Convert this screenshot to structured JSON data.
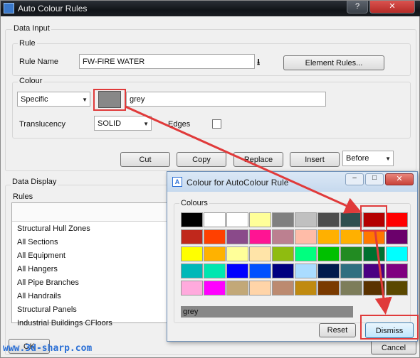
{
  "main_window": {
    "title": "Auto Colour Rules",
    "controls": [
      "?",
      "✕"
    ]
  },
  "data_input": {
    "group_label": "Data Input",
    "rule": {
      "group_label": "Rule",
      "name_label": "Rule Name",
      "name_value": "FW-FIRE WATER",
      "element_rules_button": "Element Rules..."
    },
    "colour": {
      "group_label": "Colour",
      "mode_value": "Specific",
      "swatch_color": "#888888",
      "colour_name": "grey",
      "translucency_label": "Translucency",
      "translucency_value": "SOLID",
      "edges_label": "Edges"
    },
    "buttons": {
      "cut": "Cut",
      "copy": "Copy",
      "replace": "Replace",
      "insert": "Insert",
      "position_value": "Before"
    }
  },
  "data_display": {
    "group_label": "Data Display",
    "rules_label": "Rules",
    "rows": [
      "Structural Hull Zones",
      "All Sections",
      "All Equipment",
      "All Hangers",
      "All Pipe Branches",
      "All Handrails",
      "Structural Panels",
      "Industrial Buildings CFloors"
    ],
    "ok_button": "OK",
    "cancel_button": "Cancel"
  },
  "colour_dialog": {
    "title": "Colour for AutoColour Rule",
    "group_label": "Colours",
    "palette": [
      [
        "#000000",
        "#ffffff",
        "#ffffff",
        "#ffff99",
        "#808080",
        "#c0c0c0",
        "#4d4d4d",
        "#2f4f4f",
        "#b40000",
        "#ff0000"
      ],
      [
        "#c0281c",
        "#ff4000",
        "#8a4a8a",
        "#ff1493",
        "#bc8090",
        "#ffbca8",
        "#ffb000",
        "#ffb000",
        "#ff7800",
        "#6b006b"
      ],
      [
        "#ffff00",
        "#ffb200",
        "#ffff99",
        "#ffe4a8",
        "#8fbc10",
        "#00ff7f",
        "#00c000",
        "#228b22",
        "#007030",
        "#00ffff"
      ],
      [
        "#00b8b8",
        "#00e6b0",
        "#0000ff",
        "#0050ff",
        "#000080",
        "#aadcff",
        "#001a4d",
        "#2f6f80",
        "#4b0082",
        "#800080"
      ],
      [
        "#ffaadd",
        "#ff00ff",
        "#c2a878",
        "#ffd4a8",
        "#bc8a70",
        "#c08a10",
        "#7a3a00",
        "#7d7d5a",
        "#5a3200",
        "#5a4800"
      ]
    ],
    "selected_name": "grey",
    "selected_fill": "#888888",
    "reset_button": "Reset",
    "dismiss_button": "Dismiss"
  },
  "watermark": "www.3d-sharp.com",
  "annotation_color": "#e03a3a"
}
